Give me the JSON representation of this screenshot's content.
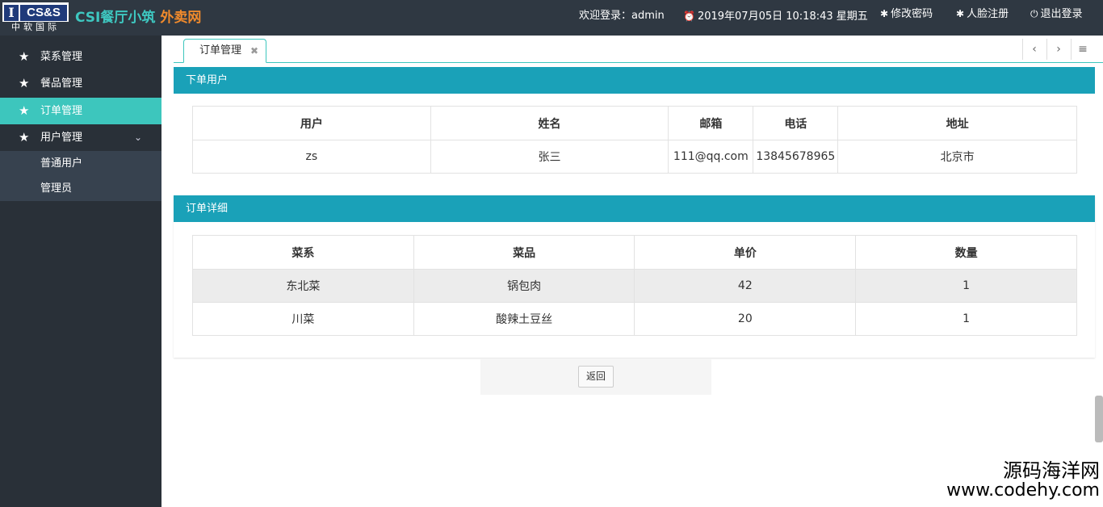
{
  "header": {
    "logo_mark": "CS&S",
    "logo_sub": "中软国际",
    "title_main": "CSI餐厅小筑",
    "title_accent": "外卖网",
    "welcome": "欢迎登录：admin",
    "datetime": "2019年07月05日 10:18:43 星期五",
    "change_password": "修改密码",
    "face_register": "人脸注册",
    "logout": "退出登录"
  },
  "sidebar": {
    "items": [
      {
        "label": "菜系管理"
      },
      {
        "label": "餐品管理"
      },
      {
        "label": "订单管理"
      },
      {
        "label": "用户管理"
      }
    ],
    "subitems": [
      {
        "label": "普通用户"
      },
      {
        "label": "管理员"
      }
    ]
  },
  "tabs": {
    "active_label": "订单管理"
  },
  "user_panel": {
    "title": "下单用户",
    "headers": [
      "用户",
      "姓名",
      "邮箱",
      "电话",
      "地址"
    ],
    "row": [
      "zs",
      "张三",
      "111@qq.com",
      "13845678965",
      "北京市"
    ]
  },
  "detail_panel": {
    "title": "订单详细",
    "headers": [
      "菜系",
      "菜品",
      "单价",
      "数量"
    ],
    "rows": [
      [
        "东北菜",
        "锅包肉",
        "42",
        "1"
      ],
      [
        "川菜",
        "酸辣土豆丝",
        "20",
        "1"
      ]
    ]
  },
  "footer": {
    "back_label": "返回"
  },
  "watermark": {
    "line1": "源码海洋网",
    "line2": "www.codehy.com"
  },
  "colors": {
    "header_bg": "#2f3842",
    "sidebar_bg": "#293038",
    "accent": "#3dc6bd",
    "panel_head": "#1aa1b8"
  }
}
